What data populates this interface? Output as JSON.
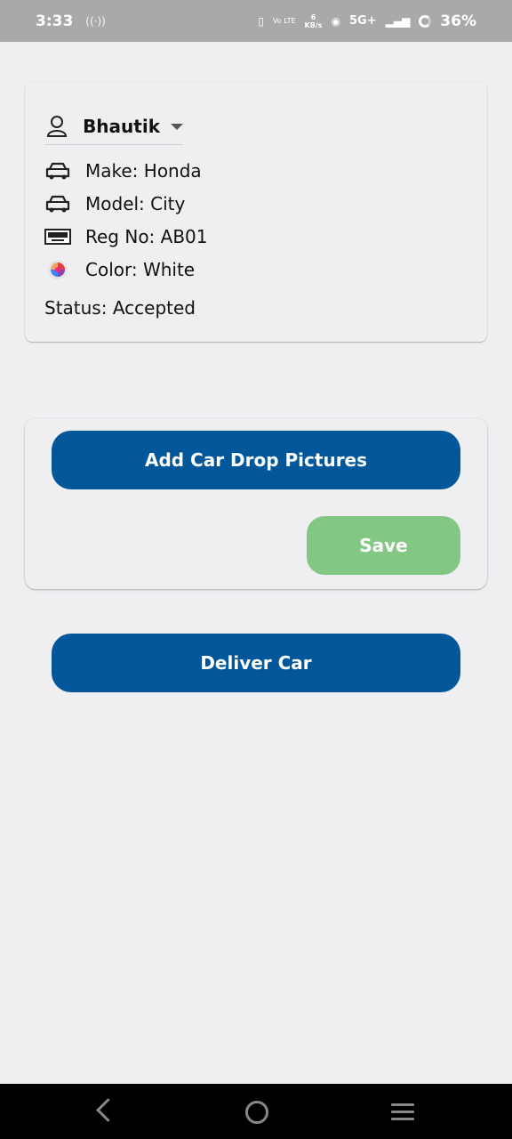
{
  "status_bar": {
    "time": "3:33",
    "battery": "36%",
    "network": "5G+",
    "volte": "Vo LTE",
    "net_speed_value": "6",
    "net_speed_unit": "KB/s"
  },
  "details_card": {
    "user_name": "Bhautik",
    "make": "Make: Honda",
    "model": "Model: City",
    "reg_no": "Reg No: AB01",
    "color": "Color: White",
    "status": "Status: Accepted"
  },
  "actions": {
    "add_pictures_label": "Add Car Drop Pictures",
    "save_label": "Save",
    "deliver_label": "Deliver Car"
  },
  "colors": {
    "primary": "#02579b",
    "save": "#83c784",
    "background": "#efeff2"
  }
}
